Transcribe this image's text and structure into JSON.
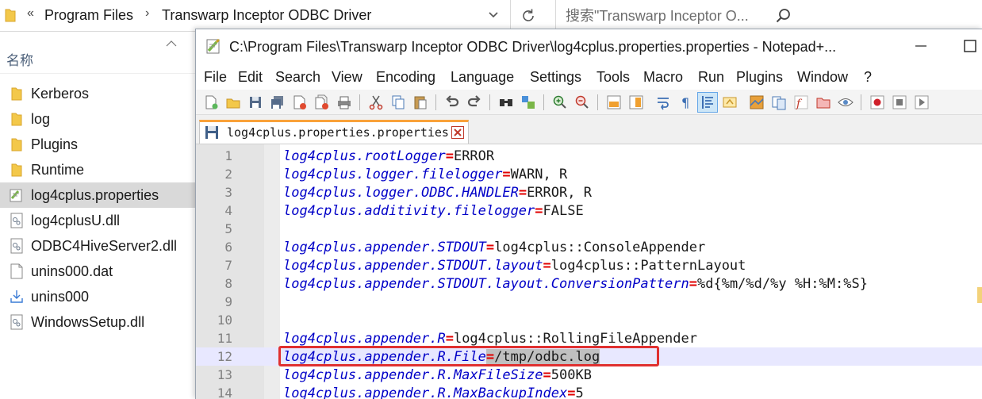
{
  "explorer": {
    "breadcrumb_overflow": "«",
    "breadcrumb": [
      "Program Files",
      "Transwarp Inceptor ODBC Driver"
    ],
    "breadcrumb_separator": "›",
    "search_placeholder": "搜索\"Transwarp Inceptor O...",
    "column_name": "名称",
    "files": [
      {
        "name": "Kerberos",
        "icon": "folder-icon"
      },
      {
        "name": "log",
        "icon": "folder-icon"
      },
      {
        "name": "Plugins",
        "icon": "folder-icon"
      },
      {
        "name": "Runtime",
        "icon": "folder-icon"
      },
      {
        "name": "log4cplus.properties",
        "icon": "notepadpp-file-icon",
        "selected": true
      },
      {
        "name": "log4cplusU.dll",
        "icon": "dll-file-icon"
      },
      {
        "name": "ODBC4HiveServer2.dll",
        "icon": "dll-file-icon"
      },
      {
        "name": "unins000.dat",
        "icon": "blank-file-icon"
      },
      {
        "name": "unins000",
        "icon": "uninstaller-icon"
      },
      {
        "name": "WindowsSetup.dll",
        "icon": "dll-file-icon"
      }
    ]
  },
  "notepad": {
    "title": "C:\\Program Files\\Transwarp Inceptor ODBC Driver\\log4cplus.properties.properties - Notepad+...",
    "menu": [
      "File",
      "Edit",
      "Search",
      "View",
      "Encoding",
      "Language",
      "Settings",
      "Tools",
      "Macro",
      "Run",
      "Plugins",
      "Window",
      "?"
    ],
    "tab_label": "log4cplus.properties.properties",
    "current_line": 12,
    "lines": [
      {
        "no": "1",
        "key": "log4cplus.rootLogger",
        "value": "ERROR"
      },
      {
        "no": "2",
        "key": "log4cplus.logger.filelogger",
        "value": "WARN, R"
      },
      {
        "no": "3",
        "key": "log4cplus.logger.ODBC.HANDLER",
        "value": "ERROR, R"
      },
      {
        "no": "4",
        "key": "log4cplus.additivity.filelogger",
        "value": "FALSE"
      },
      {
        "no": "5",
        "key": "",
        "value": ""
      },
      {
        "no": "6",
        "key": "log4cplus.appender.STDOUT",
        "value": "log4cplus::ConsoleAppender"
      },
      {
        "no": "7",
        "key": "log4cplus.appender.STDOUT.layout",
        "value": "log4cplus::PatternLayout"
      },
      {
        "no": "8",
        "key": "log4cplus.appender.STDOUT.layout.ConversionPattern",
        "value": "%d{%m/%d/%y %H:%M:%S}"
      },
      {
        "no": "9",
        "key": "",
        "value": ""
      },
      {
        "no": "10",
        "key": "",
        "value": ""
      },
      {
        "no": "11",
        "key": "log4cplus.appender.R",
        "value": "log4cplus::RollingFileAppender"
      },
      {
        "no": "12",
        "key": "log4cplus.appender.R.File",
        "value": "/tmp/odbc.log"
      },
      {
        "no": "13",
        "key": "log4cplus.appender.R.MaxFileSize",
        "value": "500KB"
      },
      {
        "no": "14",
        "key": "log4cplus.appender.R.MaxBackupIndex",
        "value": "5"
      }
    ],
    "assignment_operator": "="
  },
  "colors": {
    "key": "#0000c8",
    "operator": "#e00000",
    "highlight_box": "#e03030",
    "tab_accent": "#f9a23a",
    "current_line": "#e8e8ff"
  }
}
